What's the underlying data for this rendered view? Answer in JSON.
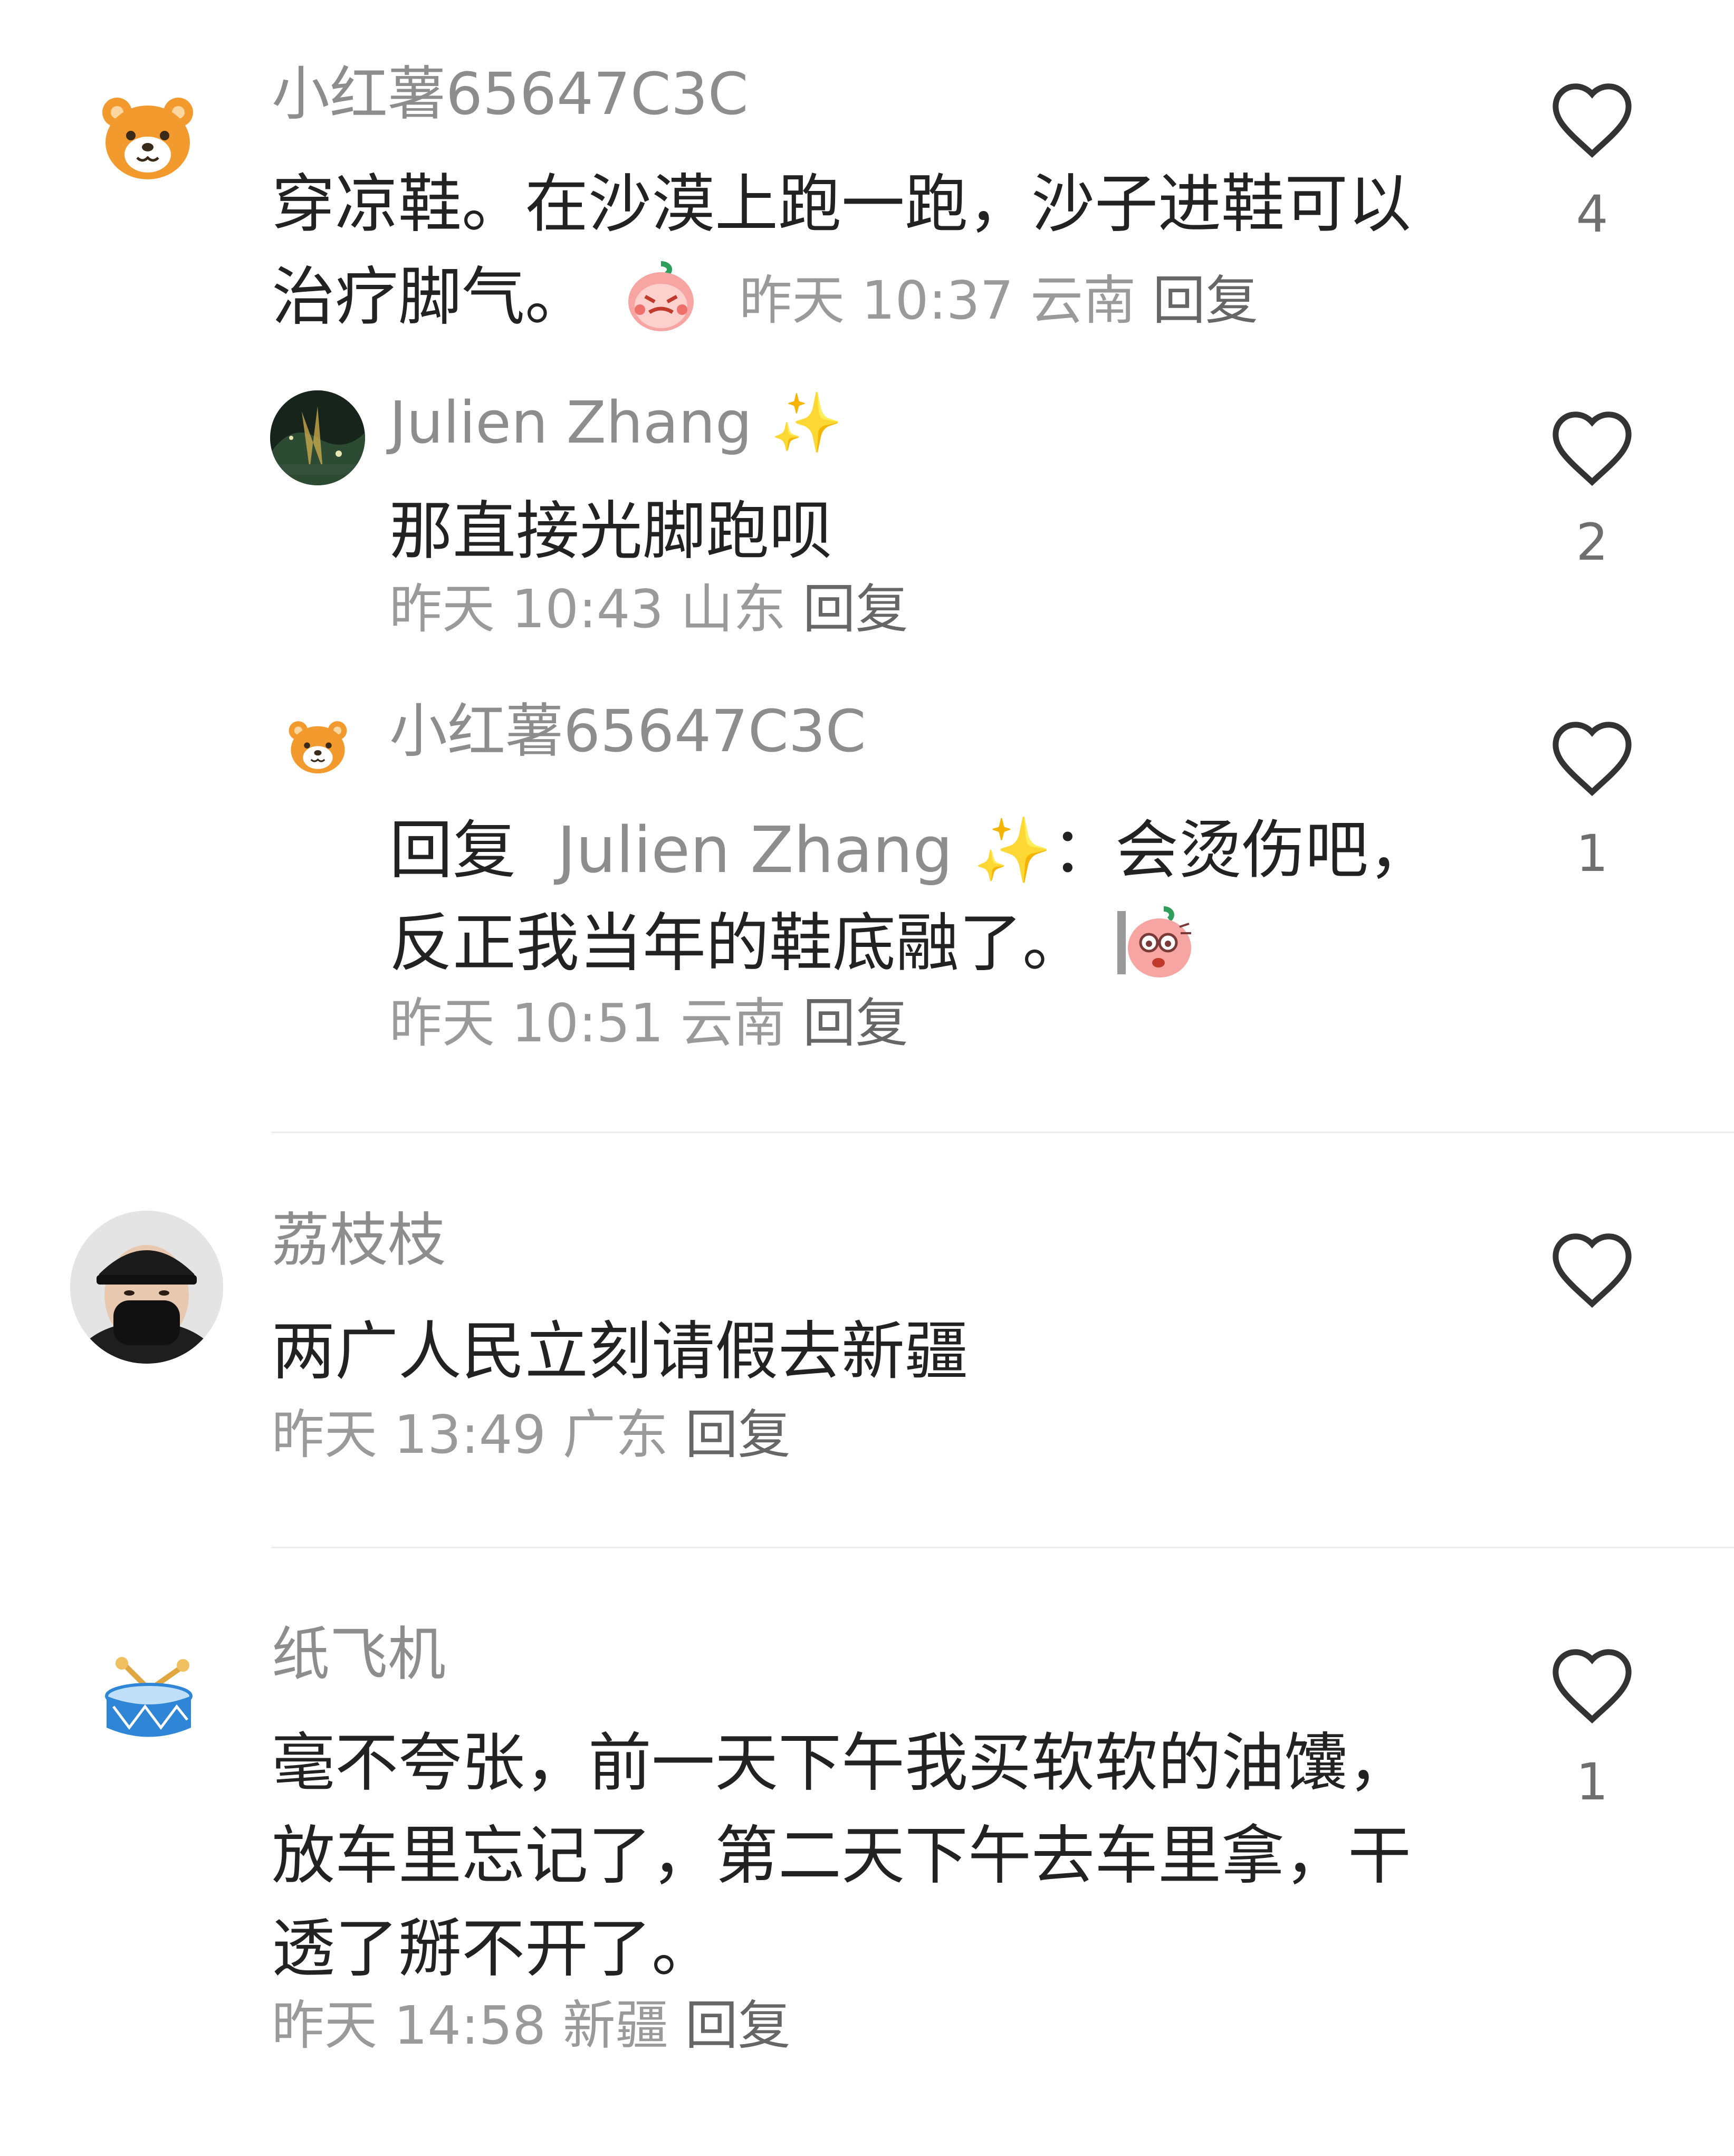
{
  "comments": [
    {
      "user": "小红薯65647C3C",
      "text": "穿凉鞋。在沙漠上跑一跑，沙子进鞋可以治疗脚气。",
      "time": "昨天 10:37",
      "location": "云南",
      "reply": "回复",
      "likes": "4",
      "avatar_icon": "bear-avatar-icon",
      "replies": [
        {
          "user": "Julien Zhang",
          "user_emoji": "✨",
          "text": "那直接光脚跑呗",
          "time": "昨天 10:43",
          "location": "山东",
          "reply": "回复",
          "likes": "2",
          "avatar_icon": "night-photo-avatar-icon"
        },
        {
          "user": "小红薯65647C3C",
          "reply_prefix": "回复",
          "reply_to": "Julien Zhang",
          "reply_to_emoji": "✨",
          "reply_sep": "：",
          "text": "会烫伤吧，反正我当年的鞋底融了。",
          "time": "昨天 10:51",
          "location": "云南",
          "reply": "回复",
          "likes": "1",
          "avatar_icon": "bear-avatar-icon"
        }
      ]
    },
    {
      "user": "荔枝枝",
      "text": "两广人民立刻请假去新疆",
      "time": "昨天 13:49",
      "location": "广东",
      "reply": "回复",
      "likes": "",
      "avatar_icon": "masked-person-avatar-icon"
    },
    {
      "user": "纸飞机",
      "text": "毫不夸张，前一天下午我买软软的油馕，放车里忘记了，第二天下午去车里拿，干透了掰不开了。",
      "time": "昨天 14:58",
      "location": "新疆",
      "reply": "回复",
      "likes": "1",
      "avatar_icon": "drum-avatar-icon"
    }
  ],
  "colors": {
    "name": "#8d8d8d",
    "text": "#222222",
    "meta": "#9a9a9a",
    "divider": "#ececec",
    "bear": "#f29a2e",
    "drum": "#2f86d6",
    "sparkle": "#f5c518"
  }
}
